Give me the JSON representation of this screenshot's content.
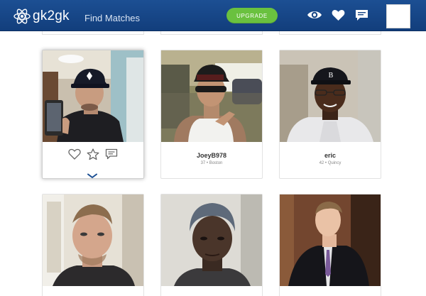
{
  "header": {
    "logo_text": "gk2gk",
    "nav_find_matches": "Find Matches",
    "upgrade_label": "UPGRADE",
    "icons": [
      "eye-icon",
      "heart-icon",
      "chat-icon"
    ]
  },
  "colors": {
    "header_bg": "#164585",
    "upgrade_bg": "#6ac13f",
    "chevron": "#1c4f93"
  },
  "matches": [
    {
      "name": "",
      "meta": "",
      "active": true
    },
    {
      "name": "JoeyB978",
      "meta": "37 • Boston",
      "active": false
    },
    {
      "name": "eric",
      "meta": "42 • Quincy",
      "active": false
    },
    {
      "name": "",
      "meta": "",
      "active": false
    },
    {
      "name": "",
      "meta": "",
      "active": false
    },
    {
      "name": "",
      "meta": "",
      "active": false
    }
  ]
}
